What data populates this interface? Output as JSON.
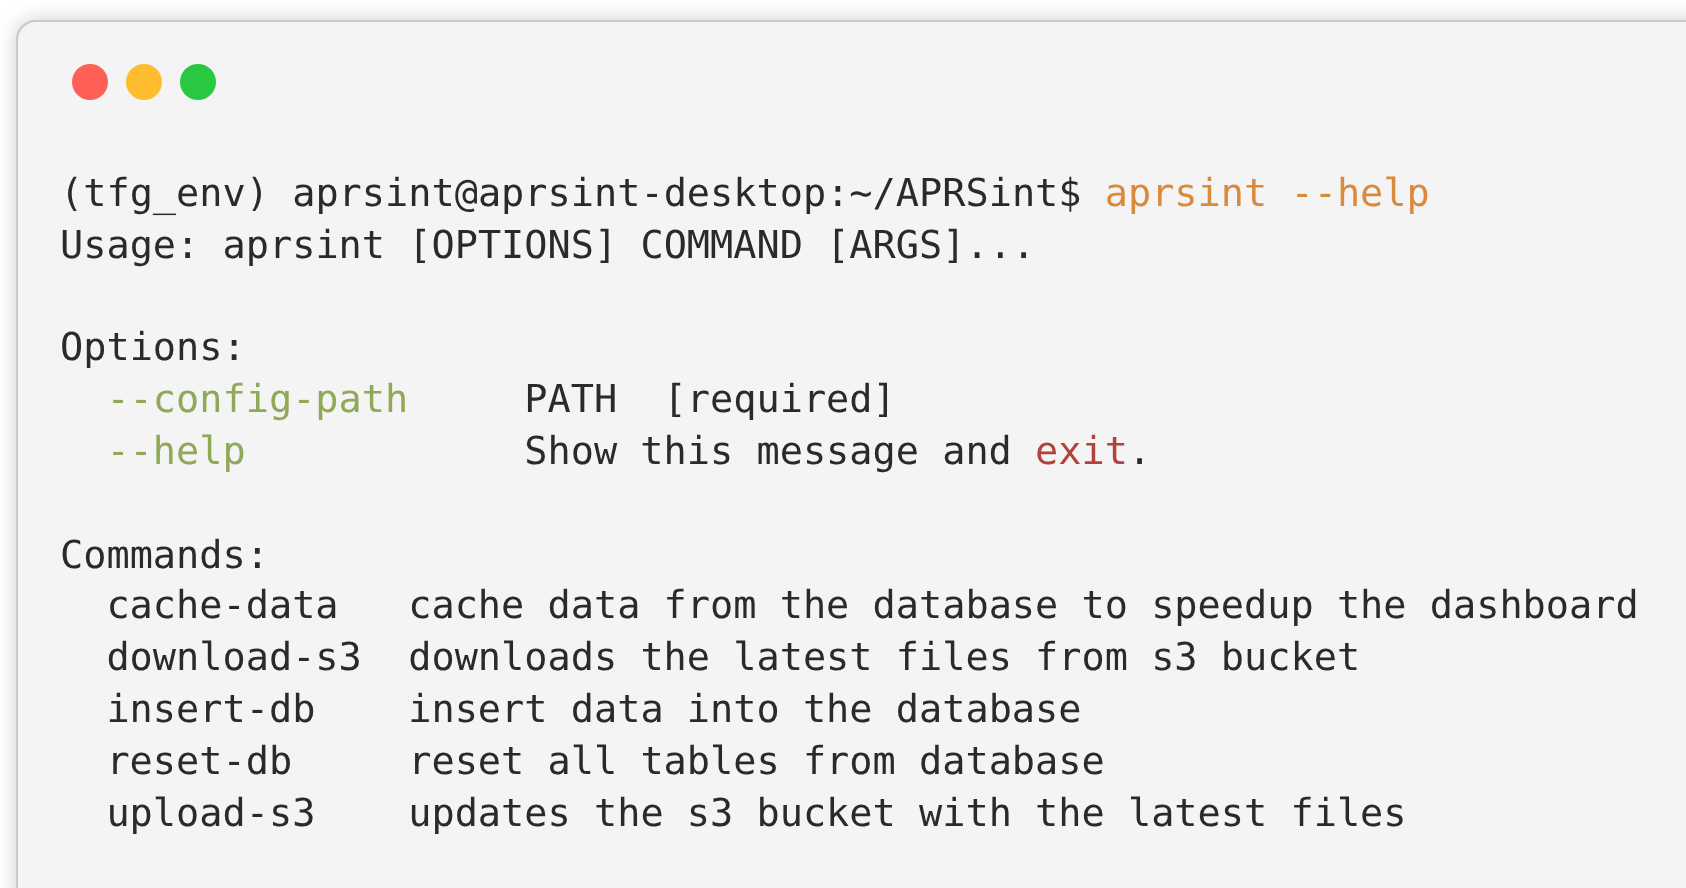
{
  "window": {
    "controls": [
      {
        "color": "#fe5f57"
      },
      {
        "color": "#febc2e"
      },
      {
        "color": "#28c840"
      }
    ]
  },
  "prompt": {
    "text": "(tfg_env) aprsint@aprsint-desktop:~/APRSint$",
    "command": "aprsint --help"
  },
  "usage": "Usage: aprsint [OPTIONS] COMMAND [ARGS]...",
  "options": {
    "heading": "Options:",
    "items": [
      {
        "name": "--config-path",
        "description": [
          {
            "text": "PATH  [required]",
            "kind": "plain"
          }
        ]
      },
      {
        "name": "--help",
        "description": [
          {
            "text": "Show this message and ",
            "kind": "plain"
          },
          {
            "text": "exit",
            "kind": "keyword"
          },
          {
            "text": ".",
            "kind": "plain"
          }
        ]
      }
    ]
  },
  "commands": {
    "heading": "Commands:",
    "items": [
      {
        "name": "cache-data",
        "description": "cache data from the database to speedup the dashboard"
      },
      {
        "name": "download-s3",
        "description": "downloads the latest files from s3 bucket"
      },
      {
        "name": "insert-db",
        "description": "insert data into the database"
      },
      {
        "name": "reset-db",
        "description": "reset all tables from database"
      },
      {
        "name": "upload-s3",
        "description": "updates the s3 bucket with the latest files"
      }
    ]
  }
}
